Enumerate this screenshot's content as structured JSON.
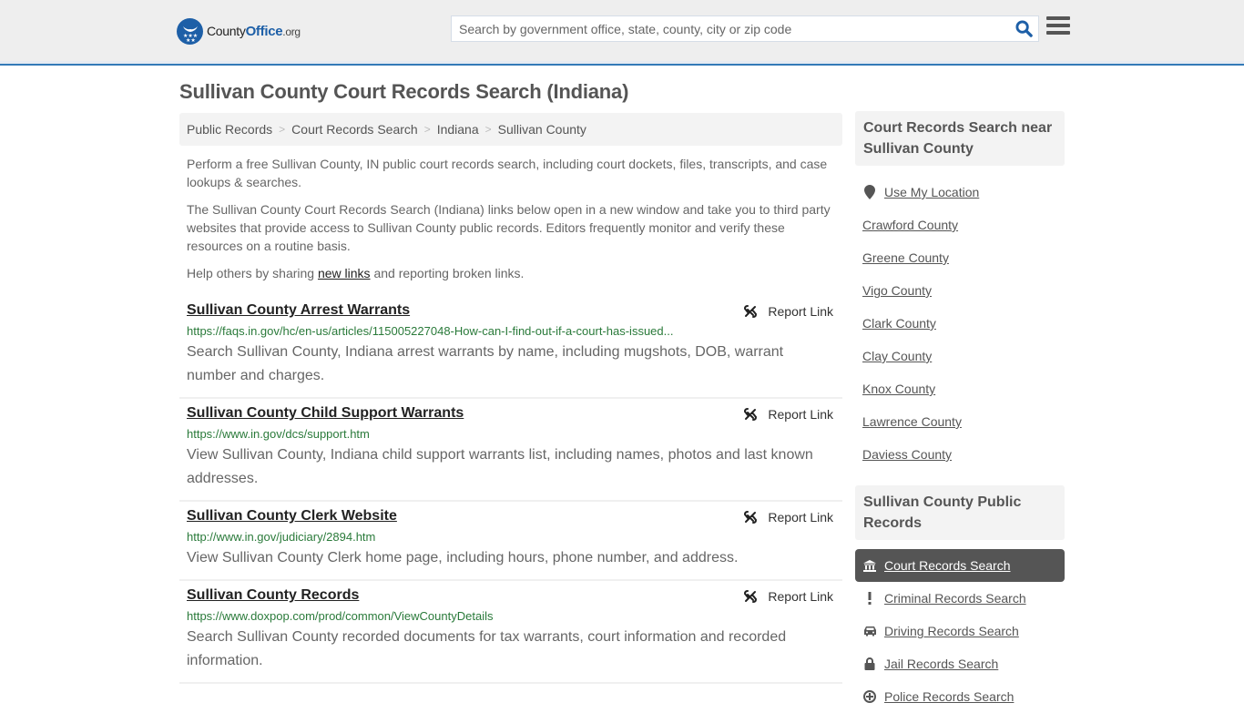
{
  "header": {
    "logo": {
      "prefix": "County",
      "brand": "Office",
      "suffix": ".org"
    },
    "search_placeholder": "Search by government office, state, county, city or zip code",
    "search_value": "",
    "icons": {
      "search": "search-icon",
      "menu": "hamburger-menu-icon"
    },
    "accent_color": "#337ab7"
  },
  "page": {
    "title": "Sullivan County Court Records Search (Indiana)",
    "breadcrumb": [
      "Public Records",
      "Court Records Search",
      "Indiana",
      "Sullivan County"
    ],
    "intro": {
      "p1": "Perform a free Sullivan County, IN public court records search, including court dockets, files, transcripts, and case lookups & searches.",
      "p2": "The Sullivan County Court Records Search (Indiana) links below open in a new window and take you to third party websites that provide access to Sullivan County public records. Editors frequently monitor and verify these resources on a routine basis.",
      "p3_before": "Help others by sharing ",
      "p3_link": "new links",
      "p3_after": " and reporting broken links."
    }
  },
  "results": [
    {
      "title": "Sullivan County Arrest Warrants",
      "url": "https://faqs.in.gov/hc/en-us/articles/115005227048-How-can-I-find-out-if-a-court-has-issued...",
      "description": "Search Sullivan County, Indiana arrest warrants by name, including mugshots, DOB, warrant number and charges.",
      "report_label": "Report Link"
    },
    {
      "title": "Sullivan County Child Support Warrants",
      "url": "https://www.in.gov/dcs/support.htm",
      "description": "View Sullivan County, Indiana child support warrants list, including names, photos and last known addresses.",
      "report_label": "Report Link"
    },
    {
      "title": "Sullivan County Clerk Website",
      "url": "http://www.in.gov/judiciary/2894.htm",
      "description": "View Sullivan County Clerk home page, including hours, phone number, and address.",
      "report_label": "Report Link"
    },
    {
      "title": "Sullivan County Records",
      "url": "https://www.doxpop.com/prod/common/ViewCountyDetails",
      "description": "Search Sullivan County recorded documents for tax warrants, court information and recorded information.",
      "report_label": "Report Link"
    }
  ],
  "sidebar": {
    "near_heading": "Court Records Search near Sullivan County",
    "use_location": "Use My Location",
    "near_counties": [
      "Crawford County",
      "Greene County",
      "Vigo County",
      "Clark County",
      "Clay County",
      "Knox County",
      "Lawrence County",
      "Daviess County"
    ],
    "public_heading": "Sullivan County Public Records",
    "public_items": [
      {
        "label": "Court Records Search",
        "icon": "courthouse-icon",
        "active": true
      },
      {
        "label": "Criminal Records Search",
        "icon": "exclamation-icon",
        "active": false
      },
      {
        "label": "Driving Records Search",
        "icon": "car-icon",
        "active": false
      },
      {
        "label": "Jail Records Search",
        "icon": "lock-icon",
        "active": false
      },
      {
        "label": "Police Records Search",
        "icon": "police-badge-icon",
        "active": false
      }
    ]
  }
}
